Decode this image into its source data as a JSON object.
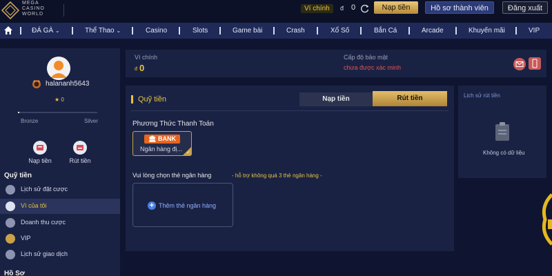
{
  "header": {
    "logo_lines": [
      "MEGA",
      "CASINO",
      "WORLD"
    ],
    "wallet_label": "Ví chính",
    "wallet_currency": "đ",
    "wallet_amount": "0",
    "deposit_button": "Nạp tiền",
    "profile_button": "Hồ sơ thành viên",
    "logout_button": "Đăng xuất"
  },
  "nav": {
    "items": [
      "ĐÁ GÀ",
      "Thể Thao",
      "Casino",
      "Slots",
      "Game bài",
      "Crash",
      "Xổ Số",
      "Bắn Cá",
      "Arcade",
      "Khuyến mãi",
      "VIP"
    ]
  },
  "sidebar": {
    "username": "halananh5643",
    "stars": "0",
    "level_progress": 0.02,
    "tier_start": "Bronze",
    "tier_end": "Silver",
    "quick_actions": [
      "Nạp tiền",
      "Rút tiền"
    ],
    "section_funds": "Quỹ tiền",
    "items": [
      "Lịch sử đặt cược",
      "Ví của tôi",
      "Doanh thu cược",
      "VIP",
      "Lịch sử giao dịch"
    ],
    "section_profile": "Hồ Sơ"
  },
  "balance": {
    "wallet_label": "Ví chính",
    "currency": "đ",
    "amount": "0",
    "security_label": "Cấp độ bảo mật",
    "security_status": "chưa được xác minh"
  },
  "funds": {
    "title": "Quỹ tiền",
    "tab_deposit": "Nạp tiền",
    "tab_withdraw": "Rút tiền",
    "method_heading": "Phương Thức Thanh Toán",
    "bank_logo": "BANK",
    "bank_name": "Ngân hàng đị...",
    "choose_heading": "Vui lòng chọn thẻ ngân hàng",
    "choose_hint": "- hỗ trợ không quá 3 thẻ ngân hàng -",
    "add_bank": "Thêm thẻ ngân hàng"
  },
  "history": {
    "title": "Lịch sử rút tiền",
    "empty": "Không có dữ liệu"
  },
  "colors": {
    "gold": "#e6c33d",
    "navy": "#1a2244",
    "nav_bar": "#1f2a59",
    "warning": "#e05252"
  }
}
